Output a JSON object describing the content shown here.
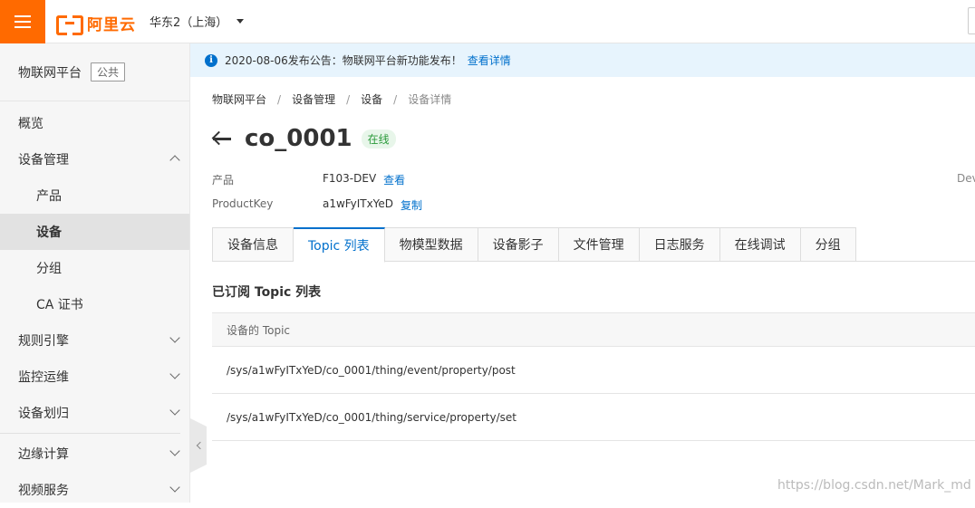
{
  "topbar": {
    "logo_text": "阿里云",
    "region": "华东2（上海）"
  },
  "sidebar": {
    "product": "物联网平台",
    "badge": "公共",
    "items": [
      {
        "label": "概览"
      },
      {
        "label": "设备管理"
      },
      {
        "label": "产品"
      },
      {
        "label": "设备"
      },
      {
        "label": "分组"
      },
      {
        "label": "CA 证书"
      },
      {
        "label": "规则引擎"
      },
      {
        "label": "监控运维"
      },
      {
        "label": "设备划归"
      },
      {
        "label": "边缘计算"
      },
      {
        "label": "视频服务"
      }
    ]
  },
  "notice": {
    "text": "2020-08-06发布公告：物联网平台新功能发布！",
    "link": "查看详情"
  },
  "breadcrumb": [
    "物联网平台",
    "设备管理",
    "设备",
    "设备详情"
  ],
  "device": {
    "name": "co_0001",
    "status": "在线",
    "product_label": "产品",
    "product_value": "F103-DEV",
    "product_action": "查看",
    "key_label": "ProductKey",
    "key_value": "a1wFyITxYeD",
    "key_action": "复制",
    "right_label": "Dev"
  },
  "tabs": [
    {
      "label": "设备信息"
    },
    {
      "label": "Topic 列表"
    },
    {
      "label": "物模型数据"
    },
    {
      "label": "设备影子"
    },
    {
      "label": "文件管理"
    },
    {
      "label": "日志服务"
    },
    {
      "label": "在线调试"
    },
    {
      "label": "分组"
    }
  ],
  "topics": {
    "section_title": "已订阅 Topic 列表",
    "column_header": "设备的 Topic",
    "rows": [
      "/sys/a1wFyITxYeD/co_0001/thing/event/property/post",
      "/sys/a1wFyITxYeD/co_0001/thing/service/property/set"
    ]
  },
  "watermark": "https://blog.csdn.net/Mark_md",
  "colors": {
    "accent": "#ff6a00",
    "link": "#0070cc",
    "online": "#2b9a3b"
  }
}
